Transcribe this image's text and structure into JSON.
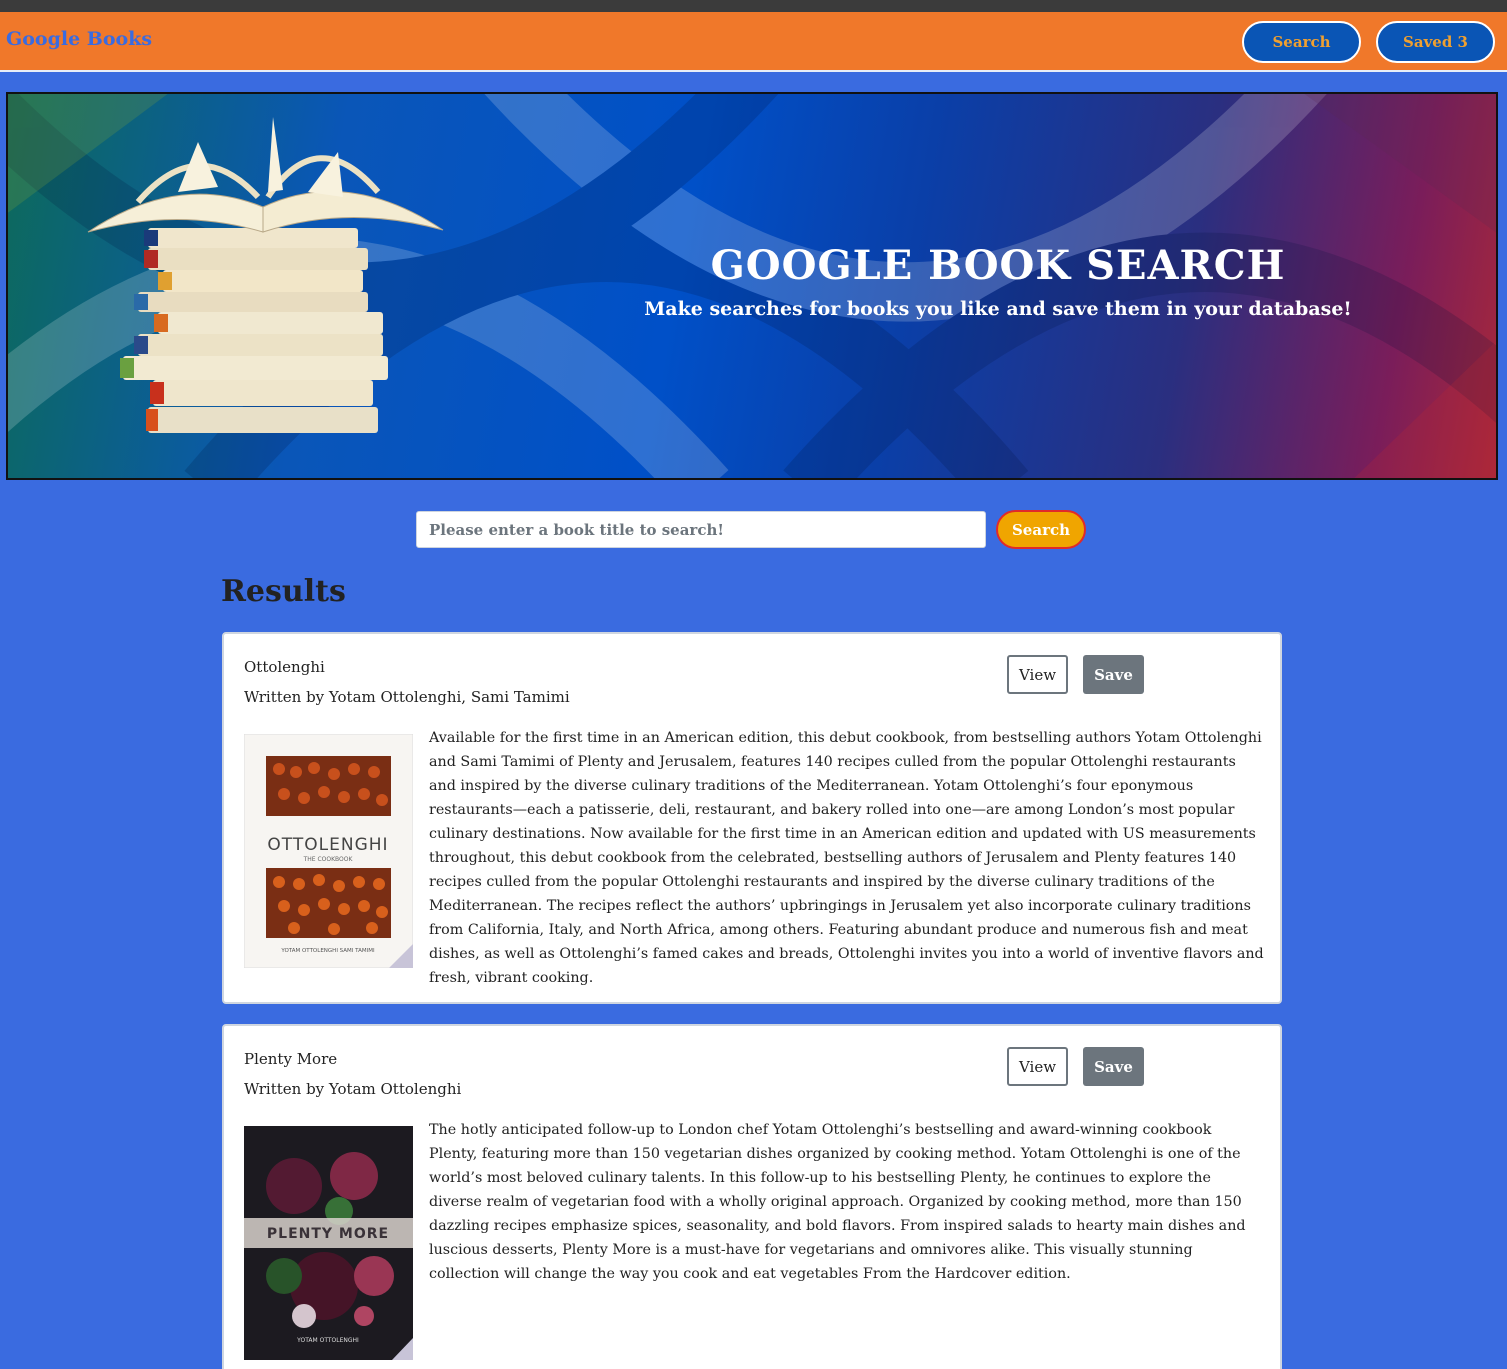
{
  "navbar": {
    "brand": "Google Books",
    "search_label": "Search",
    "saved_label": "Saved 3"
  },
  "hero": {
    "title": "GOOGLE BOOK SEARCH",
    "subtitle": "Make searches for books you like and save them in your database!"
  },
  "search": {
    "placeholder": "Please enter a book title to search!",
    "value": "",
    "button_label": "Search"
  },
  "results": {
    "heading": "Results",
    "books": [
      {
        "title": "Ottolenghi",
        "author_line": "Written by Yotam Ottolenghi, Sami Tamimi",
        "view_label": "View",
        "save_label": "Save",
        "cover_title": "OTTOLENGHI",
        "cover_subtitle": "THE COOKBOOK",
        "cover_authors": "YOTAM OTTOLENGHI    SAMI TAMIMI",
        "description": "Available for the first time in an American edition, this debut cookbook, from bestselling authors Yotam Ottolenghi and Sami Tamimi of Plenty and Jerusalem, features 140 recipes culled from the popular Ottolenghi restaurants and inspired by the diverse culinary traditions of the Mediterranean. Yotam Ottolenghi’s four eponymous restaurants—each a patisserie, deli, restaurant, and bakery rolled into one—are among London’s most popular culinary destinations. Now available for the first time in an American edition and updated with US measurements throughout, this debut cookbook from the celebrated, bestselling authors of Jerusalem and Plenty features 140 recipes culled from the popular Ottolenghi restaurants and inspired by the diverse culinary traditions of the Mediterranean. The recipes reflect the authors’ upbringings in Jerusalem yet also incorporate culinary traditions from California, Italy, and North Africa, among others. Featuring abundant produce and numerous fish and meat dishes, as well as Ottolenghi’s famed cakes and breads, Ottolenghi invites you into a world of inventive flavors and fresh, vibrant cooking."
      },
      {
        "title": "Plenty More",
        "author_line": "Written by Yotam Ottolenghi",
        "view_label": "View",
        "save_label": "Save",
        "cover_title": "PLENTY MORE",
        "cover_subtitle": "",
        "cover_authors": "YOTAM OTTOLENGHI",
        "description": "The hotly anticipated follow-up to London chef Yotam Ottolenghi’s bestselling and award-winning cookbook Plenty, featuring more than 150 vegetarian dishes organized by cooking method. Yotam Ottolenghi is one of the world’s most beloved culinary talents. In this follow-up to his bestselling Plenty, he continues to explore the diverse realm of vegetarian food with a wholly original approach. Organized by cooking method, more than 150 dazzling recipes emphasize spices, seasonality, and bold flavors. From inspired salads to hearty main dishes and luscious desserts, Plenty More is a must-have for vegetarians and omnivores alike. This visually stunning collection will change the way you cook and eat vegetables From the Hardcover edition."
      }
    ]
  }
}
